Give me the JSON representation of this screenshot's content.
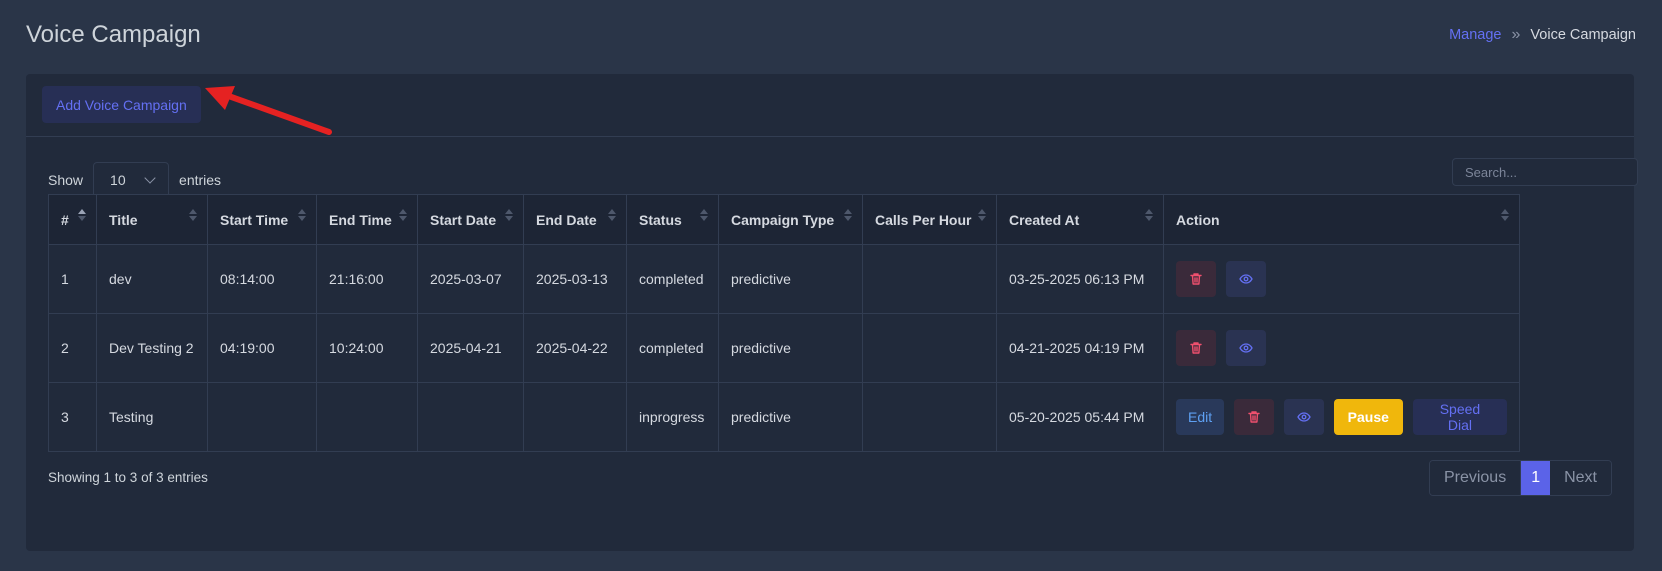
{
  "page": {
    "title": "Voice Campaign"
  },
  "breadcrumb": {
    "parent": "Manage",
    "separator": "»",
    "current": "Voice Campaign"
  },
  "toolbar": {
    "add_label": "Add Voice Campaign"
  },
  "controls": {
    "show_label": "Show",
    "entries_value": "10",
    "entries_label": "entries",
    "search_placeholder": "Search..."
  },
  "table": {
    "columns": [
      "#",
      "Title",
      "Start Time",
      "End Time",
      "Start Date",
      "End Date",
      "Status",
      "Campaign Type",
      "Calls Per Hour",
      "Created At",
      "Action"
    ],
    "rows": [
      {
        "num": "1",
        "title": "dev",
        "start_time": "08:14:00",
        "end_time": "21:16:00",
        "start_date": "2025-03-07",
        "end_date": "2025-03-13",
        "status": "completed",
        "type": "predictive",
        "calls": "",
        "created": "03-25-2025 06:13 PM"
      },
      {
        "num": "2",
        "title": "Dev Testing 2",
        "start_time": "04:19:00",
        "end_time": "10:24:00",
        "start_date": "2025-04-21",
        "end_date": "2025-04-22",
        "status": "completed",
        "type": "predictive",
        "calls": "",
        "created": "04-21-2025 04:19 PM"
      },
      {
        "num": "3",
        "title": "Testing",
        "start_time": "",
        "end_time": "",
        "start_date": "",
        "end_date": "",
        "status": "inprogress",
        "type": "predictive",
        "calls": "",
        "created": "05-20-2025 05:44 PM"
      }
    ],
    "actions": {
      "edit_label": "Edit",
      "pause_label": "Pause",
      "speed_dial_label": "Speed Dial"
    }
  },
  "footer": {
    "info": "Showing 1 to 3 of 3 entries",
    "prev_label": "Previous",
    "page": "1",
    "next_label": "Next"
  },
  "icons": {
    "delete": "trash-icon",
    "view": "eye-icon"
  },
  "colors": {
    "accent": "#6470f3",
    "delete": "#f0506e",
    "pause": "#f0b70c",
    "annotation_arrow": "#e52222"
  }
}
